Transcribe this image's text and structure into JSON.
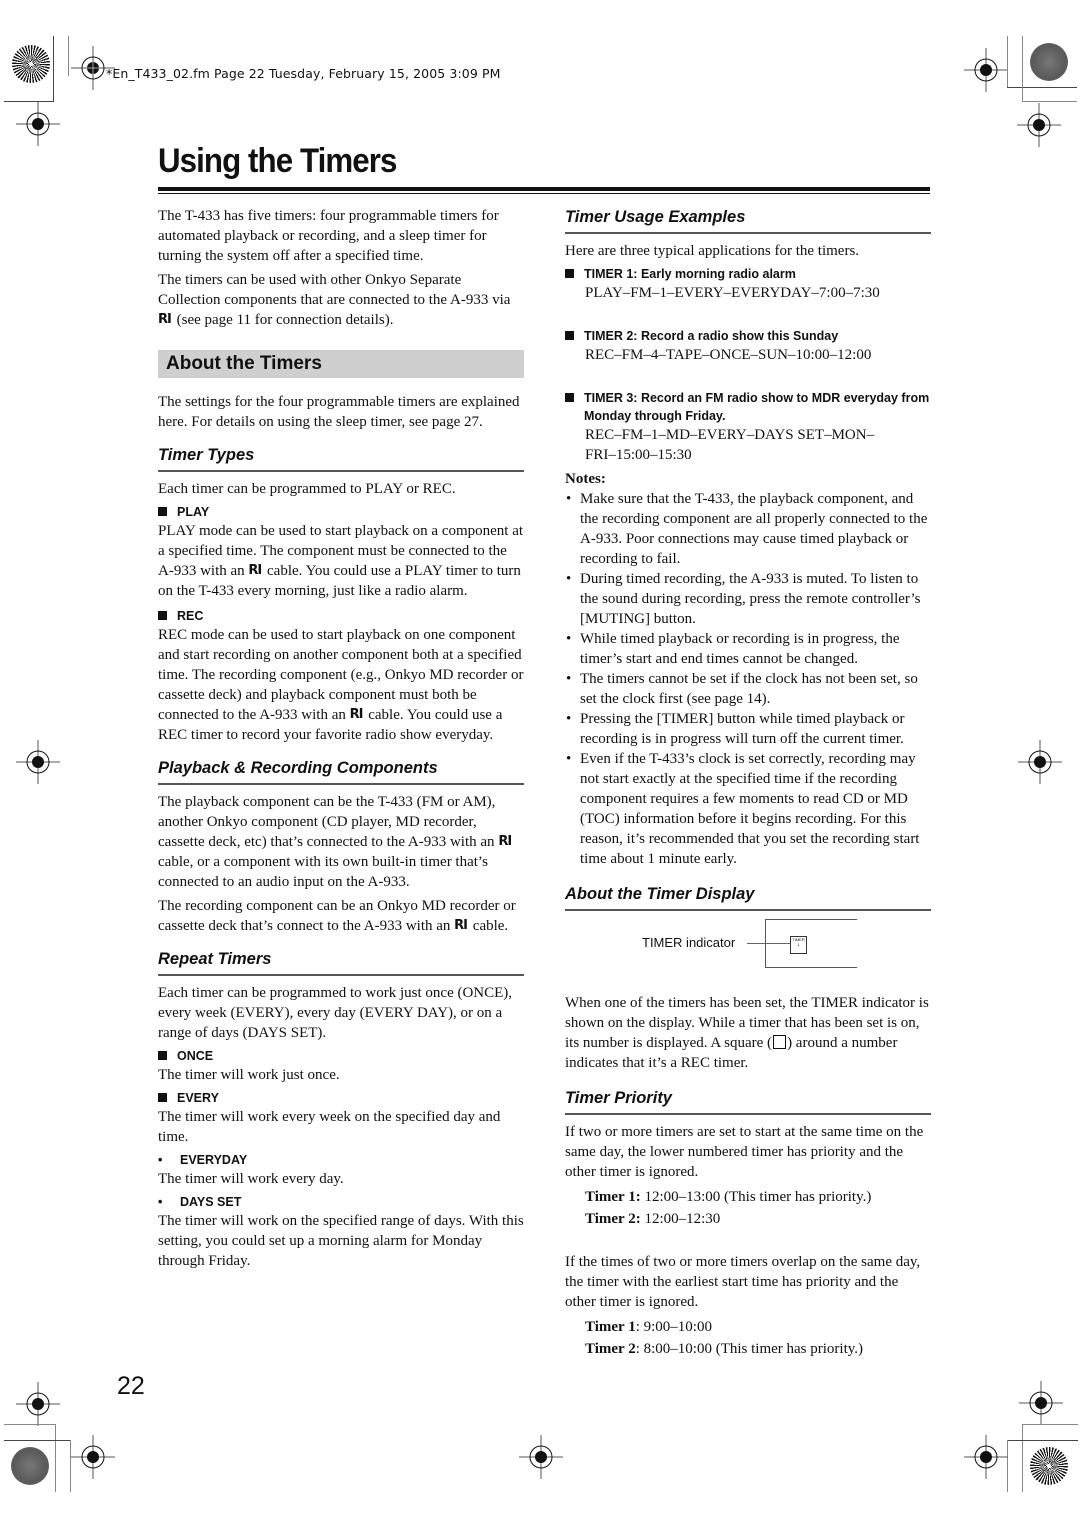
{
  "slug": "*En_T433_02.fm  Page 22  Tuesday, February 15, 2005  3:09 PM",
  "page_title": "Using the Timers",
  "page_number": "22",
  "ri_symbol": "RI",
  "intro": {
    "p1": "The T-433 has five timers: four programmable timers for automated playback or recording, and a sleep timer for turning the system off after a specified time.",
    "p2_pre": "The timers can be used with other Onkyo Separate Collection components that are connected to the A-933 via",
    "p2_post": "(see page 11 for connection details)."
  },
  "about": {
    "heading": "About the Timers",
    "text": "The settings for the four programmable timers are explained here. For details on using the sleep timer, see page 27."
  },
  "timer_types": {
    "heading": "Timer Types",
    "intro": "Each timer can be programmed to PLAY or REC.",
    "play_label": "PLAY",
    "play_pre": "PLAY mode can be used to start playback on a component at a specified time. The component must be connected to the A-933 with an",
    "play_post": "cable. You could use a PLAY timer to turn on the T-433 every morning, just like a radio alarm.",
    "rec_label": "REC",
    "rec_pre": "REC mode can be used to start playback on one component and start recording on another component both at a specified time. The recording component (e.g., Onkyo MD recorder or cassette deck) and playback component must both be connected to the A-933 with an",
    "rec_post": "cable. You could use a REC timer to record your favorite radio show everyday."
  },
  "components": {
    "heading": "Playback & Recording Components",
    "p1_pre": "The playback component can be the T-433 (FM or AM), another Onkyo component (CD player, MD recorder, cassette deck, etc) that’s connected to the A-933 with an",
    "p1_post": "cable, or a component with its own built-in timer that’s connected to an audio input on the A-933.",
    "p2_pre": "The recording component can be an Onkyo MD recorder or cassette deck that’s connect to the A-933 with an",
    "p2_post": "cable."
  },
  "repeat": {
    "heading": "Repeat Timers",
    "intro": "Each timer can be programmed to work just once (ONCE), every week (EVERY), every day (EVERY DAY), or on a range of days (DAYS SET).",
    "once_label": "ONCE",
    "once_text": "The timer will work just once.",
    "every_label": "EVERY",
    "every_text": "The timer will work every week on the specified day and time.",
    "everyday_label": "EVERYDAY",
    "everyday_text": "The timer will work every day.",
    "daysset_label": "DAYS SET",
    "daysset_text": "The timer will work on the specified range of days. With this setting, you could set up a morning alarm for Monday through Friday."
  },
  "usage": {
    "heading": "Timer Usage Examples",
    "intro": "Here are three typical applications for the timers.",
    "examples": [
      {
        "title": "TIMER 1: Early morning radio alarm",
        "code": "PLAY–FM–1–EVERY–EVERYDAY–7:00–7:30"
      },
      {
        "title": "TIMER 2: Record a radio show this Sunday",
        "code": "REC–FM–4–TAPE–ONCE–SUN–10:00–12:00"
      },
      {
        "title": "TIMER 3: Record an FM radio show to MDR everyday from Monday through Friday.",
        "code": "REC–FM–1–MD–EVERY–DAYS SET–MON–FRI–15:00–15:30"
      }
    ]
  },
  "notes": {
    "title": "Notes:",
    "items": [
      "Make sure that the T-433, the playback component, and the recording component are all properly connected to the A-933. Poor connections may cause timed playback or recording to fail.",
      "During timed recording, the A-933 is muted. To listen to the sound during recording, press the remote controller’s [MUTING] button.",
      "While timed playback or recording is in progress, the timer’s start and end times cannot be changed.",
      "The timers cannot be set if the clock has not been set, so set the clock first (see page 14).",
      "Pressing the [TIMER] button while timed playback or recording is in progress will turn off the current timer.",
      "Even if the T-433’s clock is set correctly, recording may not start exactly at the specified time if the recording component requires a few moments to read CD or MD (TOC) information before it begins recording. For this reason, it’s recommended that you set the recording start time about 1 minute early."
    ]
  },
  "display": {
    "heading": "About the Timer Display",
    "indicator_label": "TIMER indicator",
    "indicator_glyph_top": "TIMER",
    "indicator_glyph_num": "1",
    "text_pre": "When one of the timers has been set, the TIMER indicator is shown on the display. While a timer that has been set is on, its number is displayed. A square (",
    "text_post": ") around a number indicates that it’s a REC timer."
  },
  "priority": {
    "heading": "Timer Priority",
    "p1": "If two or more timers are set to start at the same time on the same day, the lower numbered timer has priority and the other timer is ignored.",
    "ex1": [
      {
        "label": "Timer 1:",
        "value": " 12:00–13:00  (This timer has priority.)"
      },
      {
        "label": "Timer 2:",
        "value": " 12:00–12:30"
      }
    ],
    "p2": "If the times of two or more timers overlap on the same day, the timer with the earliest start time has priority and the other timer is ignored.",
    "ex2": [
      {
        "label": "Timer 1",
        "value": ": 9:00–10:00"
      },
      {
        "label": "Timer 2",
        "value": ": 8:00–10:00  (This timer has priority.)"
      }
    ]
  }
}
